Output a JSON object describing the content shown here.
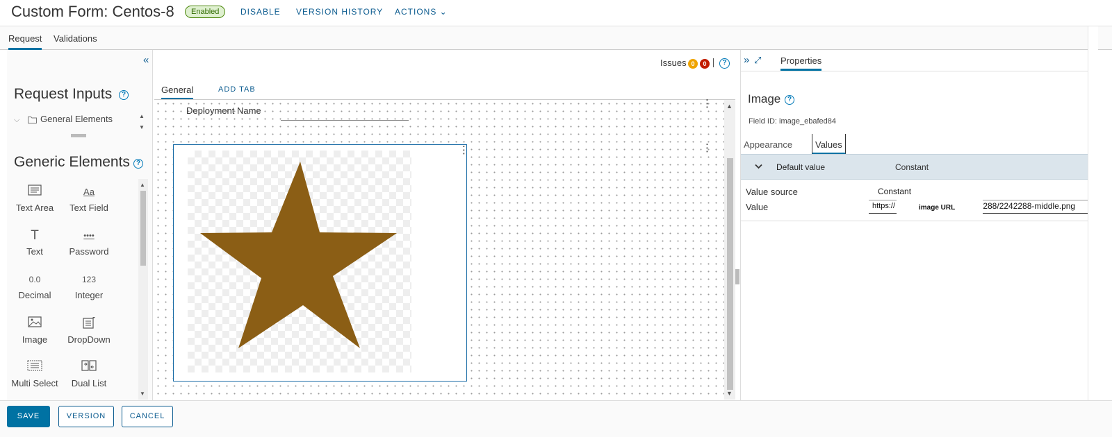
{
  "header": {
    "title": "Custom Form: Centos-8",
    "status": "Enabled",
    "disable_label": "DISABLE",
    "version_history_label": "VERSION HISTORY",
    "actions_label": "ACTIONS ⌄"
  },
  "tabs": {
    "request": "Request",
    "validations": "Validations"
  },
  "left_panel": {
    "request_inputs_title": "Request Inputs",
    "tree_item": "General Elements",
    "generic_elements_title": "Generic Elements",
    "palette": [
      {
        "label": "Text Area",
        "icon": "text-area-icon"
      },
      {
        "label": "Text Field",
        "icon": "text-field-icon",
        "glyph": "Aa"
      },
      {
        "label": "Text",
        "icon": "text-icon",
        "glyph": "T"
      },
      {
        "label": "Password",
        "icon": "password-icon",
        "glyph": "••••"
      },
      {
        "label": "Decimal",
        "icon": "decimal-icon",
        "glyph": "0.0"
      },
      {
        "label": "Integer",
        "icon": "integer-icon",
        "glyph": "123"
      },
      {
        "label": "Image",
        "icon": "image-icon"
      },
      {
        "label": "DropDown",
        "icon": "dropdown-icon"
      },
      {
        "label": "Multi Select",
        "icon": "multi-select-icon"
      },
      {
        "label": "Dual List",
        "icon": "dual-list-icon"
      }
    ]
  },
  "canvas": {
    "issues_label": "Issues",
    "warnings_count": "0",
    "errors_count": "0",
    "tab_general": "General",
    "add_tab": "ADD TAB",
    "deployment_name_label": "Deployment Name",
    "star_color": "#8B5E15"
  },
  "properties": {
    "tab_label": "Properties",
    "title": "Image",
    "field_id": "Field ID: image_ebafed84",
    "subtab_appearance": "Appearance",
    "subtab_values": "Values",
    "default_value_label": "Default value",
    "default_value_type": "Constant",
    "value_source_label": "Value source",
    "value_source_value": "Constant",
    "value_label": "Value",
    "value_prefix": "https://",
    "value_mask_label": "image  URL",
    "value_suffix": "/288/2242288-middle.png"
  },
  "footer": {
    "save": "SAVE",
    "version": "VERSION",
    "cancel": "CANCEL"
  },
  "colors": {
    "accent": "#0072a3",
    "link": "#0b5b8f",
    "warning": "#efa400",
    "error": "#c21d00"
  }
}
